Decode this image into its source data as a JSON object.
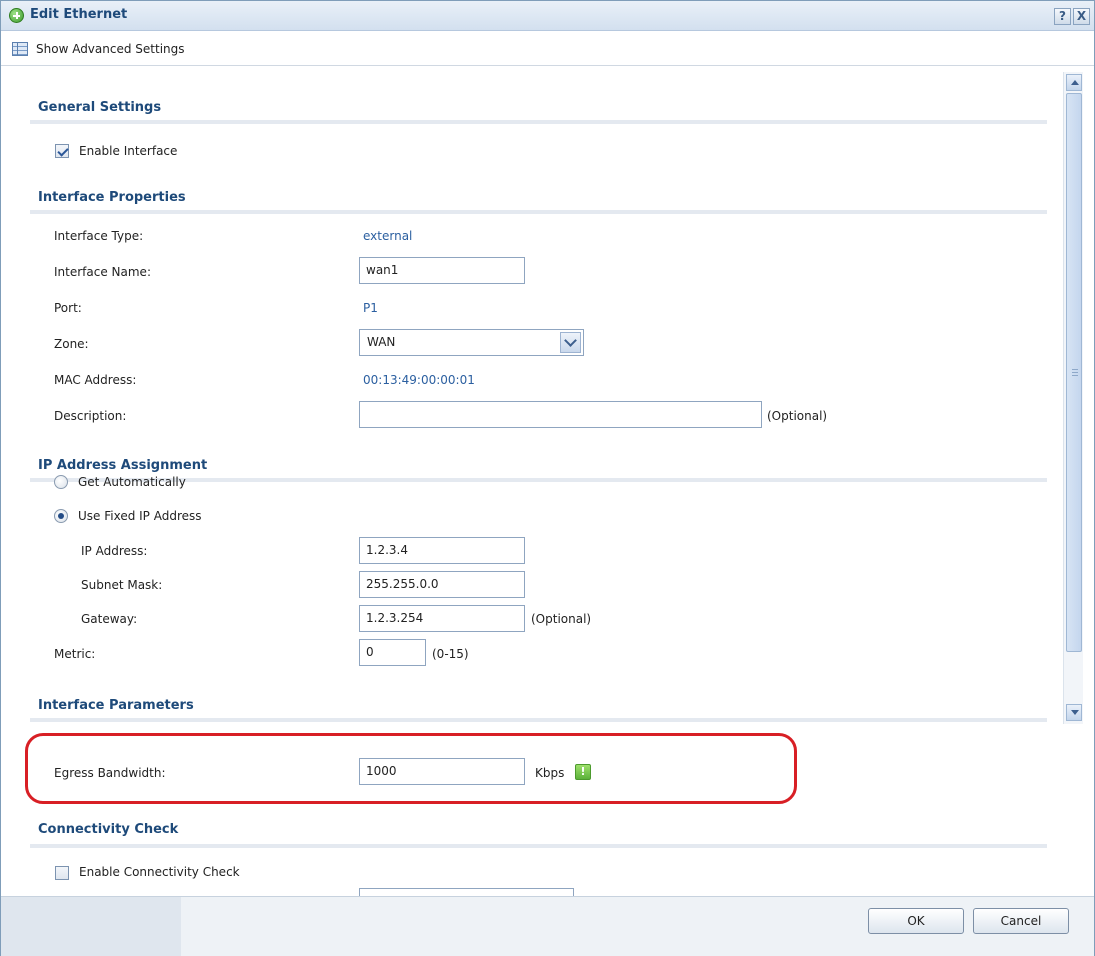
{
  "window": {
    "title": "Edit Ethernet",
    "help_label": "?",
    "close_label": "X"
  },
  "toolbar": {
    "advanced_label": "Show Advanced Settings"
  },
  "general": {
    "title": "General Settings",
    "enable_interface_label": "Enable Interface",
    "enable_interface_checked": true
  },
  "interface_properties": {
    "title": "Interface Properties",
    "type_label": "Interface Type:",
    "type_value": "external",
    "name_label": "Interface Name:",
    "name_value": "wan1",
    "port_label": "Port:",
    "port_value": "P1",
    "zone_label": "Zone:",
    "zone_value": "WAN",
    "mac_label": "MAC Address:",
    "mac_value": "00:13:49:00:00:01",
    "description_label": "Description:",
    "description_value": "",
    "description_hint": "(Optional)"
  },
  "ip_assignment": {
    "title": "IP Address Assignment",
    "get_auto_label": "Get Automatically",
    "use_fixed_label": "Use Fixed IP Address",
    "selected": "fixed",
    "ip_label": "IP Address:",
    "ip_value": "1.2.3.4",
    "subnet_label": "Subnet Mask:",
    "subnet_value": "255.255.0.0",
    "gateway_label": "Gateway:",
    "gateway_value": "1.2.3.254",
    "gateway_hint": "(Optional)",
    "metric_label": "Metric:",
    "metric_value": "0",
    "metric_hint": "(0-15)"
  },
  "interface_parameters": {
    "title": "Interface Parameters",
    "egress_label": "Egress Bandwidth:",
    "egress_value": "1000",
    "egress_unit": "Kbps",
    "info_glyph": "!"
  },
  "connectivity": {
    "title": "Connectivity Check",
    "enable_label": "Enable Connectivity Check",
    "enable_checked": false
  },
  "buttons": {
    "ok": "OK",
    "cancel": "Cancel"
  },
  "colors": {
    "section_title": "#1e4a7a",
    "link_value": "#2b5fa0",
    "highlight": "#d81f25",
    "info_icon": "#5cb13a"
  }
}
